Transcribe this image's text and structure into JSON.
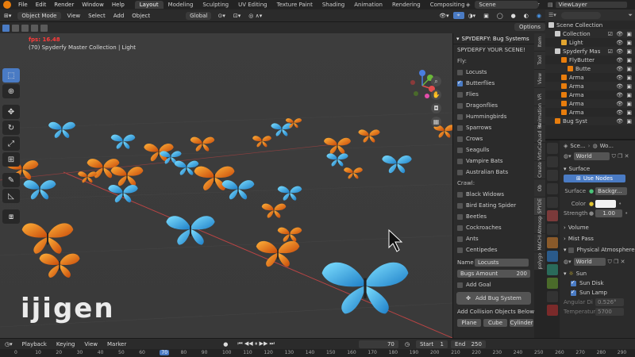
{
  "menubar": {
    "menus": [
      "File",
      "Edit",
      "Render",
      "Window",
      "Help"
    ],
    "workspaces": [
      "Layout",
      "Modeling",
      "Sculpting",
      "UV Editing",
      "Texture Paint",
      "Shading",
      "Animation",
      "Rendering",
      "Compositing",
      "Geometry Nodes",
      "Scr"
    ],
    "active_workspace": "Layout",
    "scene": "Scene",
    "view_layer": "ViewLayer"
  },
  "viewport_header": {
    "mode": "Object Mode",
    "menus": [
      "View",
      "Select",
      "Add",
      "Object"
    ],
    "transform": "Global",
    "options": "Options"
  },
  "viewport": {
    "fps": "fps: 16.48",
    "info": "(70) Spyderfy Master Collection | Light",
    "watermark": "ijigen"
  },
  "spyderfy": {
    "title": "SPYDERFY: Bug Systems",
    "subtitle": "SPYDERFY YOUR SCENE!",
    "fly_label": "Fly:",
    "fly_items": [
      {
        "label": "Locusts",
        "checked": false
      },
      {
        "label": "Butterflies",
        "checked": true
      },
      {
        "label": "Flies",
        "checked": false
      },
      {
        "label": "Dragonflies",
        "checked": false
      },
      {
        "label": "Hummingbirds",
        "checked": false
      },
      {
        "label": "Sparrows",
        "checked": false
      },
      {
        "label": "Crows",
        "checked": false
      },
      {
        "label": "Seagulls",
        "checked": false
      },
      {
        "label": "Vampire Bats",
        "checked": false
      },
      {
        "label": "Australian Bats",
        "checked": false
      }
    ],
    "crawl_label": "Crawl:",
    "crawl_items": [
      {
        "label": "Black Widows",
        "checked": false
      },
      {
        "label": "Bird Eating Spider",
        "checked": false
      },
      {
        "label": "Beetles",
        "checked": false
      },
      {
        "label": "Cockroaches",
        "checked": false
      },
      {
        "label": "Ants",
        "checked": false
      },
      {
        "label": "Centipedes",
        "checked": false
      }
    ],
    "name_label": "Name",
    "name_value": "Locusts",
    "amount_label": "Bugs Amount",
    "amount_value": "200",
    "add_goal": "Add Goal",
    "add_system": "Add Bug System",
    "collision_label": "Add Collision Objects Below:",
    "collision_buttons": [
      "Plane",
      "Cube",
      "Cylinder"
    ]
  },
  "vertical_tabs": [
    "Item",
    "Tool",
    "View",
    "VR",
    "Animation",
    "Quad Re",
    "VirtuCa",
    "Create",
    "Ob",
    "SPYDE",
    "Atmosp",
    "MACHI",
    "polygo"
  ],
  "outliner": {
    "rows": [
      {
        "label": "Scene Collection",
        "indent": 0,
        "color": "#cccccc",
        "vis": ""
      },
      {
        "label": "Collection",
        "indent": 1,
        "color": "#cccccc",
        "vis": "☑ 👁 ▣"
      },
      {
        "label": "Light",
        "indent": 2,
        "color": "#e2a530",
        "vis": "👁 ▣"
      },
      {
        "label": "Spyderfy Mas",
        "indent": 1,
        "color": "#cccccc",
        "vis": "☑ 👁 ▣"
      },
      {
        "label": "FlyButter",
        "indent": 2,
        "color": "#e87d0d",
        "vis": "👁 ▣"
      },
      {
        "label": "Butte",
        "indent": 3,
        "color": "#e87d0d",
        "vis": "👁 ▣"
      },
      {
        "label": "Arma",
        "indent": 2,
        "color": "#e87d0d",
        "vis": "👁 ▣"
      },
      {
        "label": "Arma",
        "indent": 2,
        "color": "#e87d0d",
        "vis": "👁 ▣"
      },
      {
        "label": "Arma",
        "indent": 2,
        "color": "#e87d0d",
        "vis": "👁 ▣"
      },
      {
        "label": "Arma",
        "indent": 2,
        "color": "#e87d0d",
        "vis": "👁 ▣"
      },
      {
        "label": "Arma",
        "indent": 2,
        "color": "#e87d0d",
        "vis": "👁 ▣"
      },
      {
        "label": "Bug Syst",
        "indent": 1,
        "color": "#e87d0d",
        "vis": "👁 ▣"
      }
    ]
  },
  "properties": {
    "breadcrumb": [
      "Sce...",
      "Wo..."
    ],
    "world": "World",
    "surface": "Surface",
    "use_nodes": "Use Nodes",
    "surface_label": "Surface",
    "surface_value": "Backgr...",
    "color_label": "Color",
    "color_value": "#f2f2f2",
    "strength_label": "Strength",
    "strength_value": "1.00",
    "volume": "Volume",
    "mist_pass": "Mist Pass",
    "physical_atmosphere": "Physical Atmosphere",
    "world2": "World",
    "sun": "Sun",
    "sun_disk": "Sun Disk",
    "sun_lamp": "Sun Lamp",
    "angular_d": "Angular Di",
    "angular_d_value": "0.526°",
    "temperature": "Temperature",
    "temperature_value": "5700"
  },
  "timeline": {
    "menus": [
      "Playback",
      "Keying",
      "View",
      "Marker"
    ],
    "current_frame": "70",
    "start_label": "Start",
    "start_value": "1",
    "end_label": "End",
    "end_value": "250",
    "ticks": [
      "0",
      "10",
      "20",
      "30",
      "40",
      "50",
      "60",
      "70",
      "80",
      "90",
      "100",
      "110",
      "120",
      "130",
      "140",
      "150",
      "160",
      "170",
      "180",
      "190",
      "200",
      "210",
      "220",
      "230",
      "240",
      "250",
      "260",
      "270",
      "280",
      "290"
    ]
  }
}
